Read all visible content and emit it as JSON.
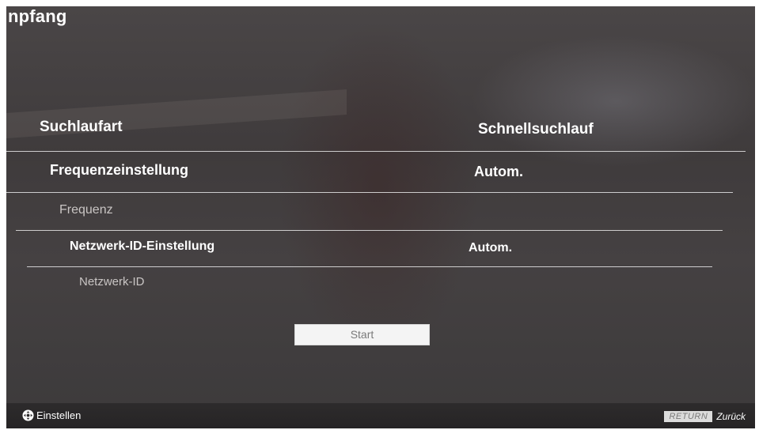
{
  "screen": {
    "title": "npfang"
  },
  "settings": [
    {
      "label": "Suchlaufart",
      "value": "Schnellsuchlauf",
      "enabled": true
    },
    {
      "label": "Frequenzeinstellung",
      "value": "Autom.",
      "enabled": true
    },
    {
      "label": "Frequenz",
      "value": "",
      "enabled": false
    },
    {
      "label": "Netzwerk-ID-Einstellung",
      "value": "Autom.",
      "enabled": true
    },
    {
      "label": "Netzwerk-ID",
      "value": "",
      "enabled": false
    }
  ],
  "start_button": {
    "label": "Start"
  },
  "footer": {
    "left_icon": "dpad-icon",
    "left_label": "Einstellen",
    "return_key_label": "RETURN",
    "right_label": "Zurück"
  }
}
